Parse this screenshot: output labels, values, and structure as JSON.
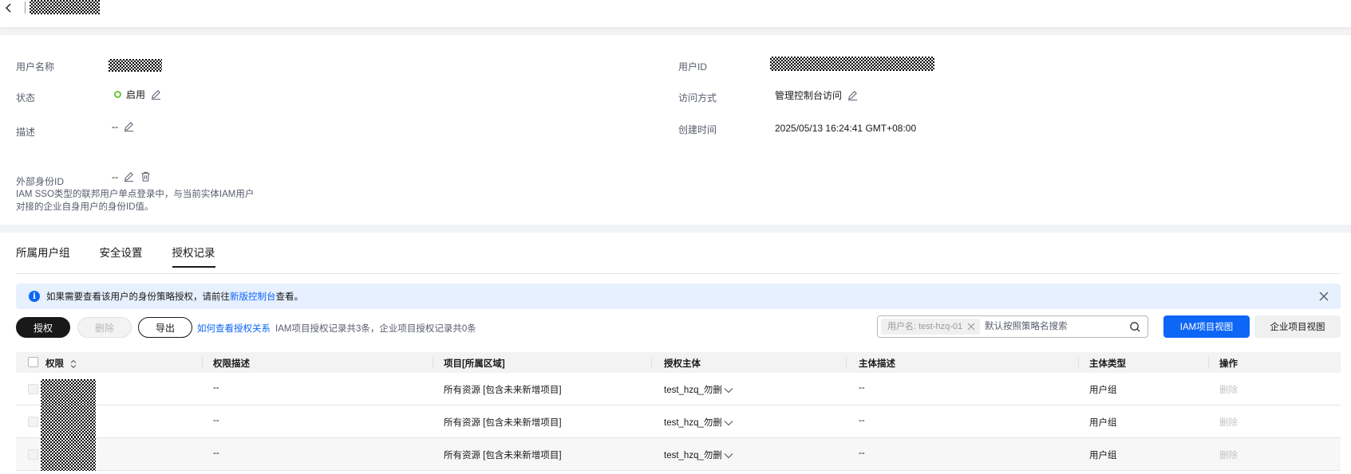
{
  "header": {
    "title_redacted": true
  },
  "info": {
    "username_label": "用户名称",
    "userid_label": "用户ID",
    "status_label": "状态",
    "status_value": "启用",
    "access_label": "访问方式",
    "access_value": "管理控制台访问",
    "desc_label": "描述",
    "desc_value": "--",
    "created_label": "创建时间",
    "created_value": "2025/05/13 16:24:41 GMT+08:00",
    "extid_label": "外部身份ID",
    "extid_value": "--",
    "extid_hint_1": "IAM SSO类型的联邦用户单点登录中，与当前实体IAM用户",
    "extid_hint_2": "对接的企业自身用户的身份ID值。"
  },
  "tabs": [
    {
      "label": "所属用户组",
      "active": false
    },
    {
      "label": "安全设置",
      "active": false
    },
    {
      "label": "授权记录",
      "active": true
    }
  ],
  "alert": {
    "text_before": "如果需要查看该用户的身份策略授权，请前往",
    "link": "新版控制台",
    "text_after": "查看。"
  },
  "toolbar": {
    "grant_label": "授权",
    "delete_label": "删除",
    "export_label": "导出",
    "howto_link": "如何查看授权关系",
    "count_text": "IAM项目授权记录共3条，企业项目授权记录共0条",
    "search_tag": "用户名: test-hzq-01",
    "search_placeholder": "默认按照策略名搜索",
    "view_iam": "IAM项目视图",
    "view_enterprise": "企业项目视图"
  },
  "table": {
    "columns": [
      "权限",
      "权限描述",
      "项目[所属区域]",
      "授权主体",
      "主体描述",
      "主体类型",
      "操作"
    ],
    "rows": [
      {
        "desc": "--",
        "project": "所有资源 [包含未来新增项目]",
        "principal": "test_hzq_勿删",
        "principal_desc": "--",
        "type": "用户组",
        "action": "删除"
      },
      {
        "desc": "--",
        "project": "所有资源 [包含未来新增项目]",
        "principal": "test_hzq_勿删",
        "principal_desc": "--",
        "type": "用户组",
        "action": "删除"
      },
      {
        "desc": "--",
        "project": "所有资源 [包含未来新增项目]",
        "principal": "test_hzq_勿删",
        "principal_desc": "--",
        "type": "用户组",
        "action": "删除"
      }
    ]
  },
  "colors": {
    "primary": "#0d66f5",
    "dark": "#191919",
    "status_green": "#6bc33a",
    "alert_bg": "#e6f0ff"
  }
}
